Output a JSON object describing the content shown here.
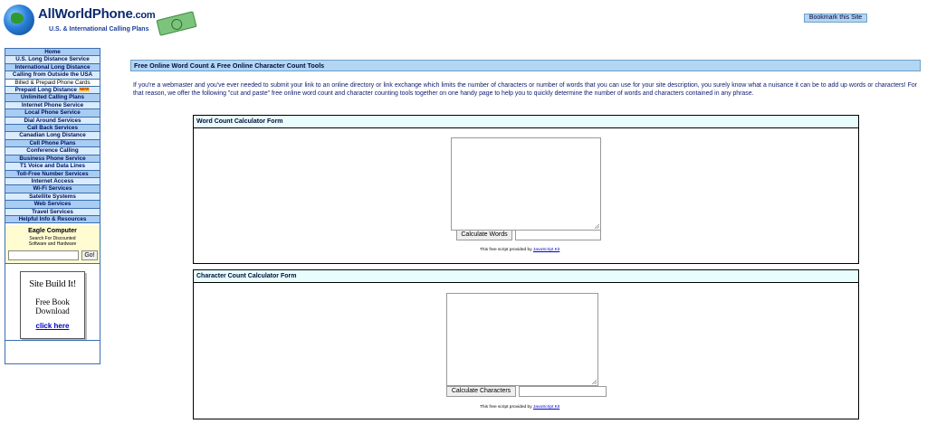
{
  "header": {
    "logo_title": "AllWorldPhone",
    "logo_tld": ".com",
    "logo_subtitle": "U.S. & International Calling Plans",
    "bookmark_label": "Bookmark this Site"
  },
  "sidebar": {
    "items": [
      {
        "label": "Home"
      },
      {
        "label": "U.S. Long Distance Service"
      },
      {
        "label": "International Long Distance"
      },
      {
        "label": "Calling from Outside the USA"
      },
      {
        "label": "Billed & Prepaid Phone Cards"
      },
      {
        "label": "Prepaid Long Distance",
        "badge": "NEW"
      },
      {
        "label": "Unlimited Calling Plans"
      },
      {
        "label": "Internet Phone Service"
      },
      {
        "label": "Local Phone Service"
      },
      {
        "label": "Dial Around Services"
      },
      {
        "label": "Call Back Services"
      },
      {
        "label": "Canadian Long Distance"
      },
      {
        "label": "Cell Phone Plans"
      },
      {
        "label": "Conference Calling"
      },
      {
        "label": "Business Phone Service"
      },
      {
        "label": "T1 Voice and Data Lines"
      },
      {
        "label": "Toll-Free Number Services"
      },
      {
        "label": "Internet Access"
      },
      {
        "label": "Wi-Fi Services"
      },
      {
        "label": "Satellite Systems"
      },
      {
        "label": "Web Services"
      },
      {
        "label": "Travel Services"
      },
      {
        "label": "Helpful Info & Resources"
      }
    ],
    "eagle": {
      "title": "Eagle Computer",
      "line1": "Search For Discounted",
      "line2": "Software and Hardware",
      "go_label": "Go!"
    },
    "sbi": {
      "title": "Site Build It!",
      "line1": "Free Book",
      "line2": "Download",
      "link": "click here"
    }
  },
  "main": {
    "heading": "Free Online Word Count & Free Online Character Count Tools",
    "intro": "If you're a webmaster and you've ever needed to submit your link to an online directory or link exchange which limits the number of characters or number of words that you can use for your site description, you surely know what a nuisance it can be to add up words or characters! For that reason, we offer the following \"cut and paste\" free online word count and character counting tools together on one handy page to help you to quickly determine the number of words and characters contained in any phrase.",
    "word_form": {
      "title": "Word Count Calculator Form",
      "button": "Calculate Words",
      "credit_text": "This free script provided by",
      "credit_link": "JavaScript Kit"
    },
    "char_form": {
      "title": "Character Count Calculator Form",
      "button": "Calculate Characters",
      "credit_text": "This free script provided by",
      "credit_link": "JavaScript Kit"
    }
  },
  "colors": {
    "nav_blue": "#a9ccf2",
    "nav_light": "#d9ebfc",
    "heading_bg": "#b3d6f5",
    "form_head_bg": "#e8fdfd",
    "link": "#0000cc"
  }
}
